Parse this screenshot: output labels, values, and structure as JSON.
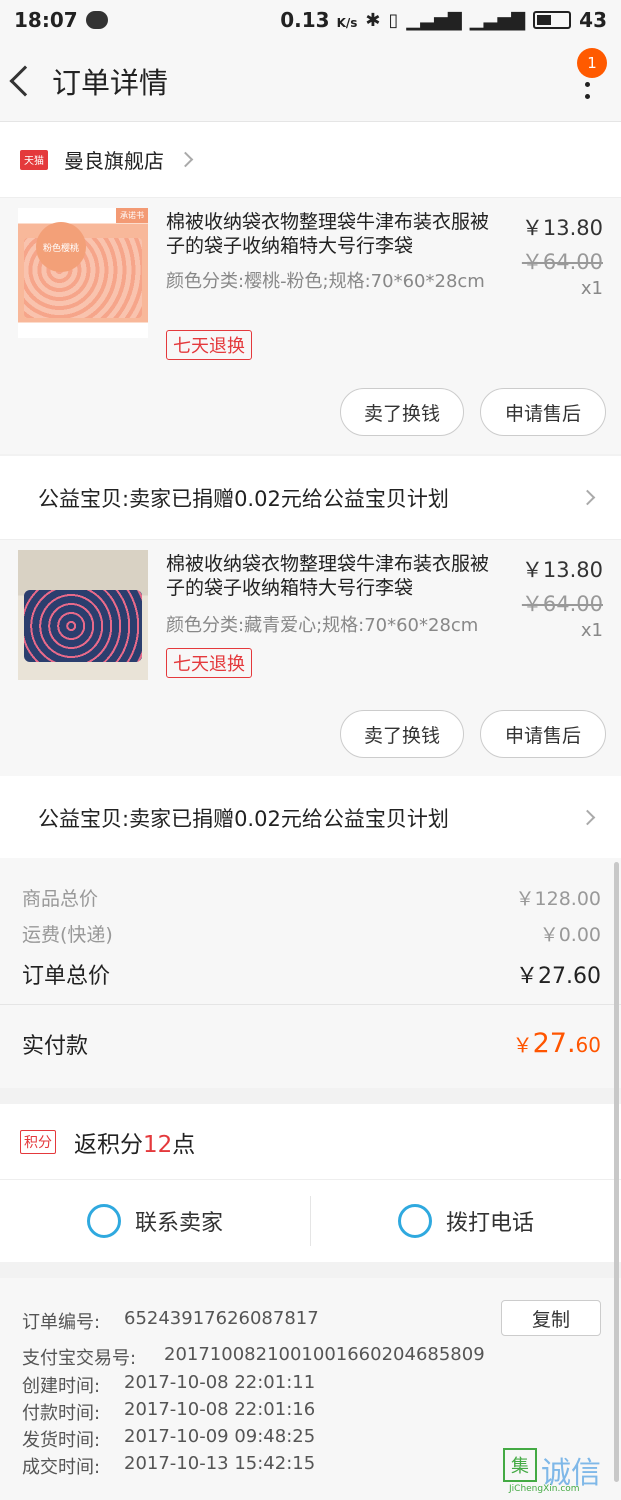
{
  "status_bar": {
    "time": "18:07",
    "speed": "0.13",
    "speed_unit": "K/s",
    "battery": "43"
  },
  "header": {
    "title": "订单详情",
    "badge_count": "1"
  },
  "store": {
    "platform_tag": "天猫",
    "name": "曼良旗舰店"
  },
  "items": [
    {
      "title": "棉被收纳袋衣物整理袋牛津布装衣服被子的袋子收纳箱特大号行李袋",
      "spec": "颜色分类:樱桃-粉色;规格:70*60*28cm",
      "return_tag": "七天退换",
      "price": "￥13.80",
      "original_price": "￥64.00",
      "qty": "x1",
      "thumb_label": "粉色樱桃",
      "thumb_tag": "承诺书",
      "btn_sell": "卖了换钱",
      "btn_service": "申请售后",
      "charity": "公益宝贝:卖家已捐赠0.02元给公益宝贝计划"
    },
    {
      "title": "棉被收纳袋衣物整理袋牛津布装衣服被子的袋子收纳箱特大号行李袋",
      "spec": "颜色分类:藏青爱心;规格:70*60*28cm",
      "return_tag": "七天退换",
      "price": "￥13.80",
      "original_price": "￥64.00",
      "qty": "x1",
      "btn_sell": "卖了换钱",
      "btn_service": "申请售后",
      "charity": "公益宝贝:卖家已捐赠0.02元给公益宝贝计划"
    }
  ],
  "summary": {
    "goods_total_label": "商品总价",
    "goods_total": "￥128.00",
    "shipping_label": "运费(快递)",
    "shipping": "￥0.00",
    "order_total_label": "订单总价",
    "order_total": "￥27.60",
    "paid_label": "实付款",
    "paid_currency": "￥",
    "paid_int": "27.",
    "paid_dec": "60"
  },
  "points": {
    "tag": "积分",
    "prefix": "返积分",
    "num": "12",
    "suffix": "点"
  },
  "contact": {
    "seller": "联系卖家",
    "phone": "拨打电话"
  },
  "order_info": {
    "copy_label": "复制",
    "rows": [
      {
        "k": "订单编号:",
        "v": "65243917626087817"
      },
      {
        "k": "支付宝交易号:",
        "v": "2017100821001001660204685809"
      },
      {
        "k": "创建时间:",
        "v": "2017-10-08 22:01:11"
      },
      {
        "k": "付款时间:",
        "v": "2017-10-08 22:01:16"
      },
      {
        "k": "发货时间:",
        "v": "2017-10-09 09:48:25"
      },
      {
        "k": "成交时间:",
        "v": "2017-10-13 15:42:15"
      }
    ]
  },
  "watermark": {
    "box": "集",
    "big": "诚信",
    "sub": "JiChengXin.com"
  },
  "colors": {
    "accent": "#ff5500",
    "tmall_red": "#e4393c",
    "contact_blue": "#2fa9df"
  }
}
